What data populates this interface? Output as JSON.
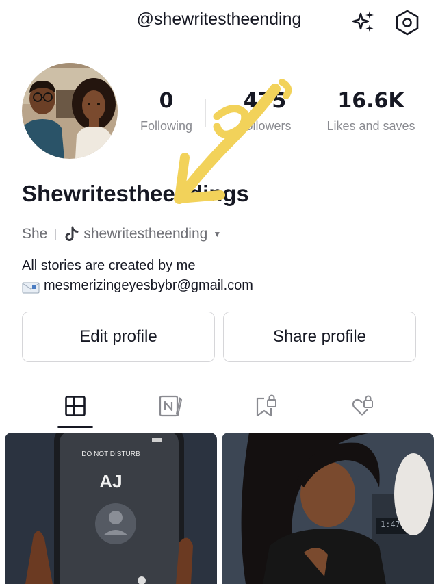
{
  "header": {
    "handle": "@shewritestheending",
    "icons": [
      "sparkles-icon",
      "settings-hexagon-icon"
    ]
  },
  "stats": {
    "following": {
      "value": "0",
      "label": "Following"
    },
    "followers": {
      "value": "475",
      "label": "Followers"
    },
    "likes": {
      "value": "16.6K",
      "label": "Likes and saves"
    }
  },
  "profile": {
    "display_name": "Shewritestheendings",
    "pronoun": "She",
    "tiktok_handle": "shewritestheending",
    "bio_line1": "All stories are created by me",
    "bio_email": "mesmerizingeyesbybr@gmail.com"
  },
  "buttons": {
    "edit": "Edit profile",
    "share": "Share profile"
  },
  "tabs": [
    "grid-tab",
    "notes-tab",
    "saved-tab",
    "liked-tab"
  ],
  "posts": [
    {
      "dnd_label": "DO NOT DISTURB",
      "caller": "AJ"
    },
    {
      "clock": "1:47"
    }
  ],
  "colors": {
    "text": "#161823",
    "muted": "#8a8b91",
    "annotation": "#f2d25a"
  }
}
